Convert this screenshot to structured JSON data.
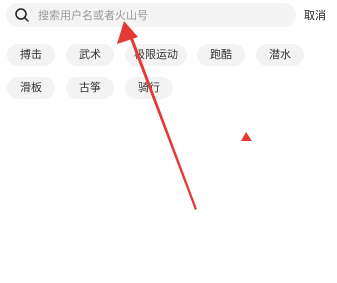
{
  "search": {
    "placeholder": "搜索用户名或者火山号",
    "value": ""
  },
  "header": {
    "cancel_label": "取消"
  },
  "tags": [
    {
      "label": "搏击"
    },
    {
      "label": "武术"
    },
    {
      "label": "极限运动"
    },
    {
      "label": "跑酷"
    },
    {
      "label": "潜水"
    },
    {
      "label": "滑板"
    },
    {
      "label": "古筝"
    },
    {
      "label": "骑行"
    }
  ],
  "colors": {
    "annotation": "#e53935",
    "chip_background": "#f3f3f4",
    "search_background": "#f4f4f5"
  },
  "icons": {
    "search": "search-icon"
  }
}
